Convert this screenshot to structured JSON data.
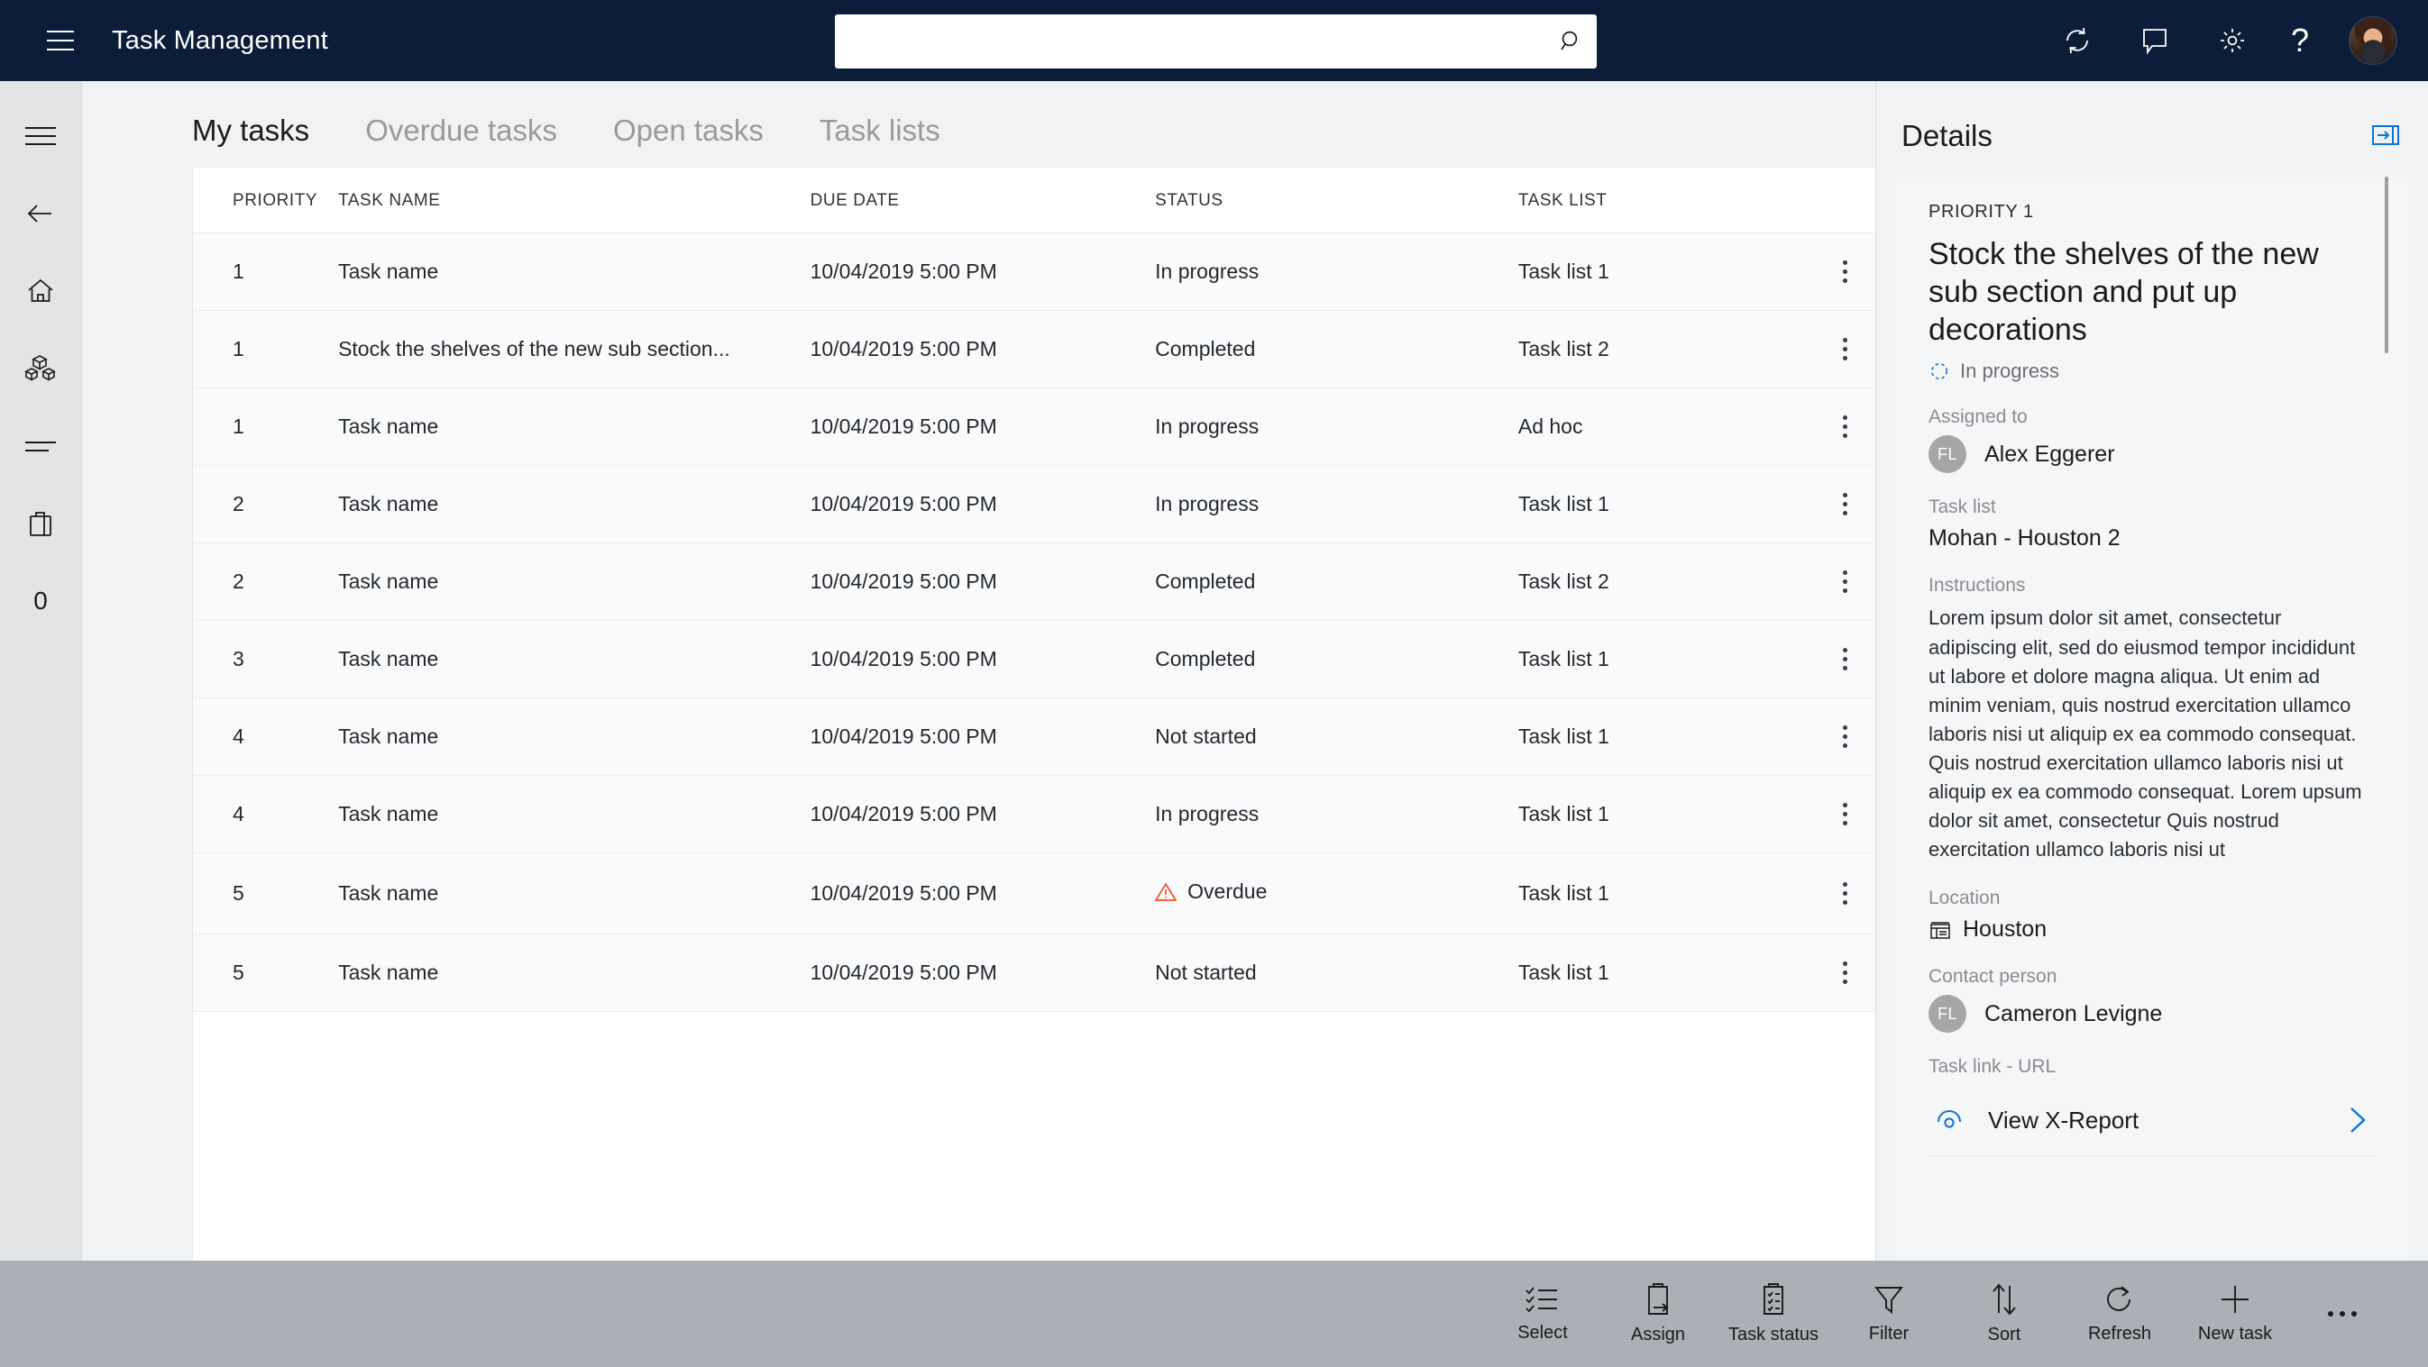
{
  "app": {
    "title": "Task Management"
  },
  "search": {
    "value": "",
    "placeholder": ""
  },
  "topbar_icons": [
    {
      "name": "refresh-icon",
      "label": "Refresh"
    },
    {
      "name": "chat-icon",
      "label": "Chat"
    },
    {
      "name": "settings-gear-icon",
      "label": "Settings"
    },
    {
      "name": "help-icon",
      "label": "?"
    }
  ],
  "sidebar": {
    "items": [
      {
        "name": "menu-icon",
        "label": "Menu"
      },
      {
        "name": "back-arrow-icon",
        "label": "Back"
      },
      {
        "name": "home-icon",
        "label": "Home"
      },
      {
        "name": "products-icon",
        "label": "Products"
      },
      {
        "name": "list-icon",
        "label": "List"
      },
      {
        "name": "shopping-bag-icon",
        "label": "Bag"
      },
      {
        "name": "counter-badge",
        "label": "0"
      }
    ]
  },
  "tabs": [
    {
      "label": "My tasks",
      "active": true
    },
    {
      "label": "Overdue tasks",
      "active": false
    },
    {
      "label": "Open tasks",
      "active": false
    },
    {
      "label": "Task lists",
      "active": false
    }
  ],
  "table": {
    "columns": [
      "PRIORITY",
      "TASK NAME",
      "DUE DATE",
      "STATUS",
      "TASK LIST"
    ],
    "rows": [
      {
        "priority": "1",
        "task_name": "Task name",
        "due_date": "10/04/2019 5:00 PM",
        "status": "In progress",
        "task_list": "Task list 1",
        "overdue": false
      },
      {
        "priority": "1",
        "task_name": "Stock the shelves of the new sub section...",
        "due_date": "10/04/2019 5:00 PM",
        "status": "Completed",
        "task_list": "Task list 2",
        "overdue": false
      },
      {
        "priority": "1",
        "task_name": "Task name",
        "due_date": "10/04/2019 5:00 PM",
        "status": "In progress",
        "task_list": "Ad hoc",
        "overdue": false
      },
      {
        "priority": "2",
        "task_name": "Task name",
        "due_date": "10/04/2019 5:00 PM",
        "status": "In progress",
        "task_list": "Task list 1",
        "overdue": false
      },
      {
        "priority": "2",
        "task_name": "Task name",
        "due_date": "10/04/2019 5:00 PM",
        "status": "Completed",
        "task_list": "Task list 2",
        "overdue": false
      },
      {
        "priority": "3",
        "task_name": "Task name",
        "due_date": "10/04/2019 5:00 PM",
        "status": "Completed",
        "task_list": "Task list 1",
        "overdue": false
      },
      {
        "priority": "4",
        "task_name": "Task name",
        "due_date": "10/04/2019 5:00 PM",
        "status": "Not started",
        "task_list": "Task list 1",
        "overdue": false
      },
      {
        "priority": "4",
        "task_name": "Task name",
        "due_date": "10/04/2019 5:00 PM",
        "status": "In progress",
        "task_list": "Task list 1",
        "overdue": false
      },
      {
        "priority": "5",
        "task_name": "Task name",
        "due_date": "10/04/2019 5:00 PM",
        "status": "Overdue",
        "task_list": "Task list 1",
        "overdue": true
      },
      {
        "priority": "5",
        "task_name": "Task name",
        "due_date": "10/04/2019 5:00 PM",
        "status": "Not started",
        "task_list": "Task list 1",
        "overdue": false
      }
    ]
  },
  "details": {
    "header": "Details",
    "priority": "PRIORITY 1",
    "task_title": "Stock the shelves of the new sub section and put up decorations",
    "status": "In progress",
    "assigned_to_label": "Assigned to",
    "assigned_to_initials": "FL",
    "assigned_to_name": "Alex Eggerer",
    "task_list_label": "Task list",
    "task_list_value": "Mohan - Houston 2",
    "instructions_label": "Instructions",
    "instructions": "Lorem ipsum dolor sit amet, consectetur adipiscing elit, sed do eiusmod tempor incididunt ut labore et dolore magna aliqua. Ut enim ad minim veniam, quis nostrud exercitation ullamco laboris nisi ut aliquip ex ea commodo consequat. Quis nostrud exercitation ullamco laboris nisi ut aliquip ex ea commodo consequat. Lorem upsum dolor sit amet, consectetur Quis nostrud exercitation ullamco laboris nisi ut",
    "location_label": "Location",
    "location_value": "Houston",
    "contact_label": "Contact person",
    "contact_initials": "FL",
    "contact_name": "Cameron Levigne",
    "task_link_label": "Task link - URL",
    "task_link_text": "View X-Report"
  },
  "toolbar": {
    "items": [
      {
        "name": "select-button",
        "label": "Select"
      },
      {
        "name": "assign-button",
        "label": "Assign"
      },
      {
        "name": "task-status-button",
        "label": "Task status"
      },
      {
        "name": "filter-button",
        "label": "Filter"
      },
      {
        "name": "sort-button",
        "label": "Sort"
      },
      {
        "name": "refresh-button",
        "label": "Refresh"
      },
      {
        "name": "new-task-button",
        "label": "New task"
      }
    ]
  },
  "colors": {
    "header_bg": "#0b1d38",
    "accent_blue": "#0b74d4",
    "overdue_red": "#f24f23",
    "toolbar_bg": "#aab0b6",
    "rail_bg": "#e2e4e6"
  }
}
